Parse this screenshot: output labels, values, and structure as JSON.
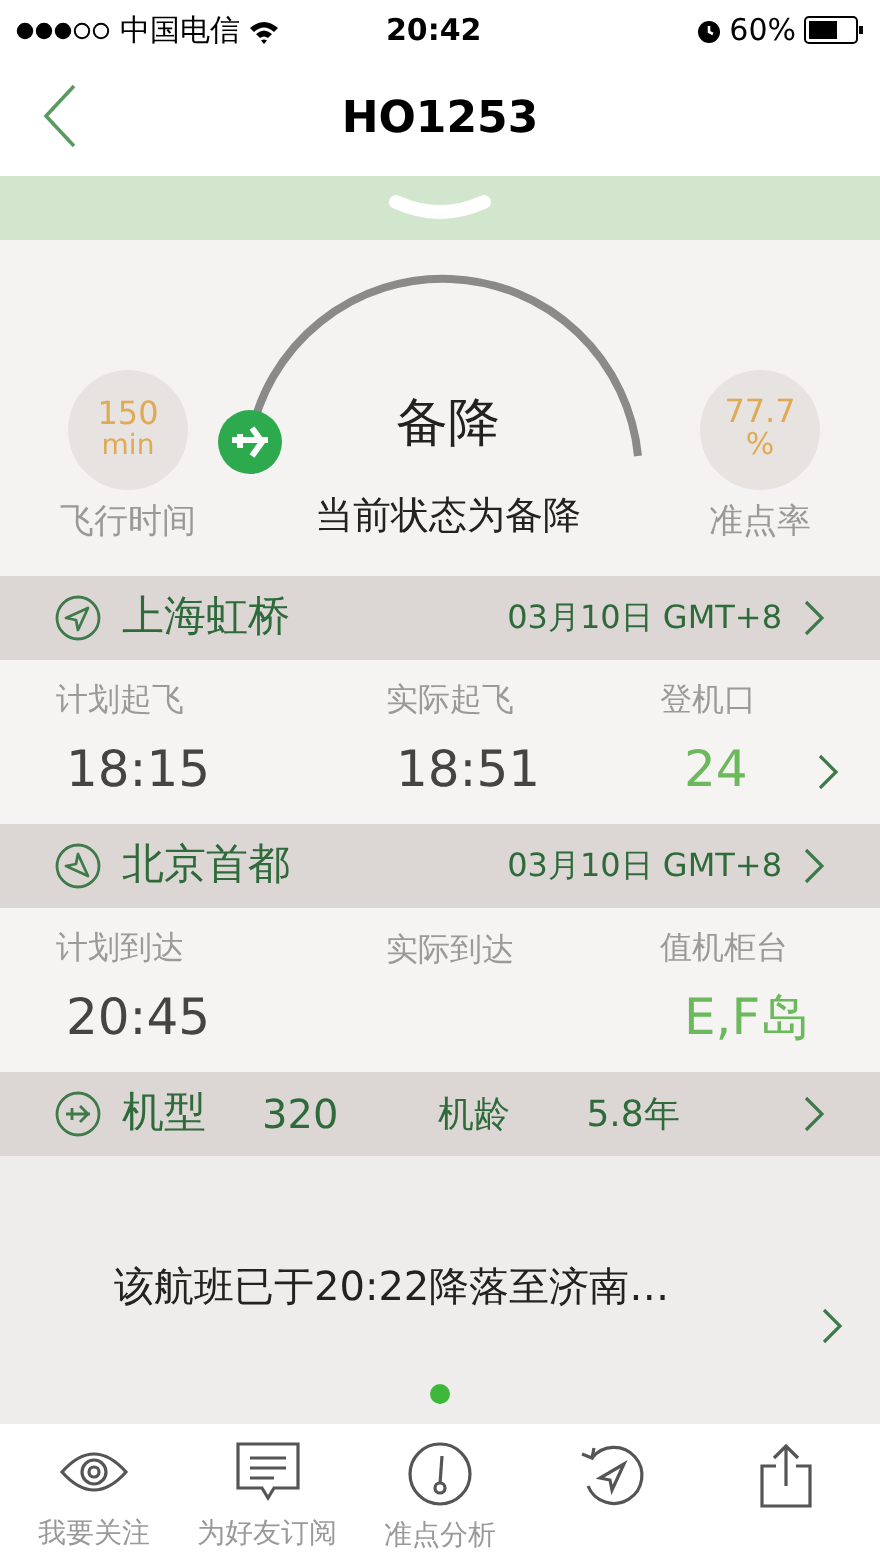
{
  "status_bar": {
    "carrier": "中国电信",
    "time": "20:42",
    "battery": "60%"
  },
  "nav": {
    "title": "HO1253"
  },
  "status": {
    "duration": {
      "value": "150",
      "unit": "min",
      "label": "飞行时间"
    },
    "state": "备降",
    "description": "当前状态为备降",
    "punctuality": {
      "value": "77.7",
      "unit": "%",
      "label": "准点率"
    }
  },
  "legs": [
    {
      "kind": "departure",
      "airport": "上海虹桥",
      "date": "03月10日 GMT+8",
      "fields": [
        {
          "label": "计划起飞",
          "value": "18:15"
        },
        {
          "label": "实际起飞",
          "value": "18:51"
        },
        {
          "label": "登机口",
          "value": "24"
        }
      ],
      "has_arrow": true
    },
    {
      "kind": "arrival",
      "airport": "北京首都",
      "date": "03月10日 GMT+8",
      "fields": [
        {
          "label": "计划到达",
          "value": "20:45"
        },
        {
          "label": "实际到达"
        },
        {
          "label": "值机柜台",
          "value": "E,F岛"
        }
      ],
      "has_arrow": false
    }
  ],
  "aircraft": {
    "type_label": "机型",
    "type": "320",
    "age_label": "机龄",
    "age": "5.8年"
  },
  "message": "该航班已于20:22降落至济南…",
  "pages": [
    {
      "selected": true
    }
  ],
  "tabs": [
    {
      "kind": "eye",
      "label": "我要关注"
    },
    {
      "kind": "chat",
      "label": "为好友订阅"
    },
    {
      "kind": "gauge",
      "label": "准点分析"
    },
    {
      "kind": "refresh"
    },
    {
      "kind": "share"
    }
  ]
}
